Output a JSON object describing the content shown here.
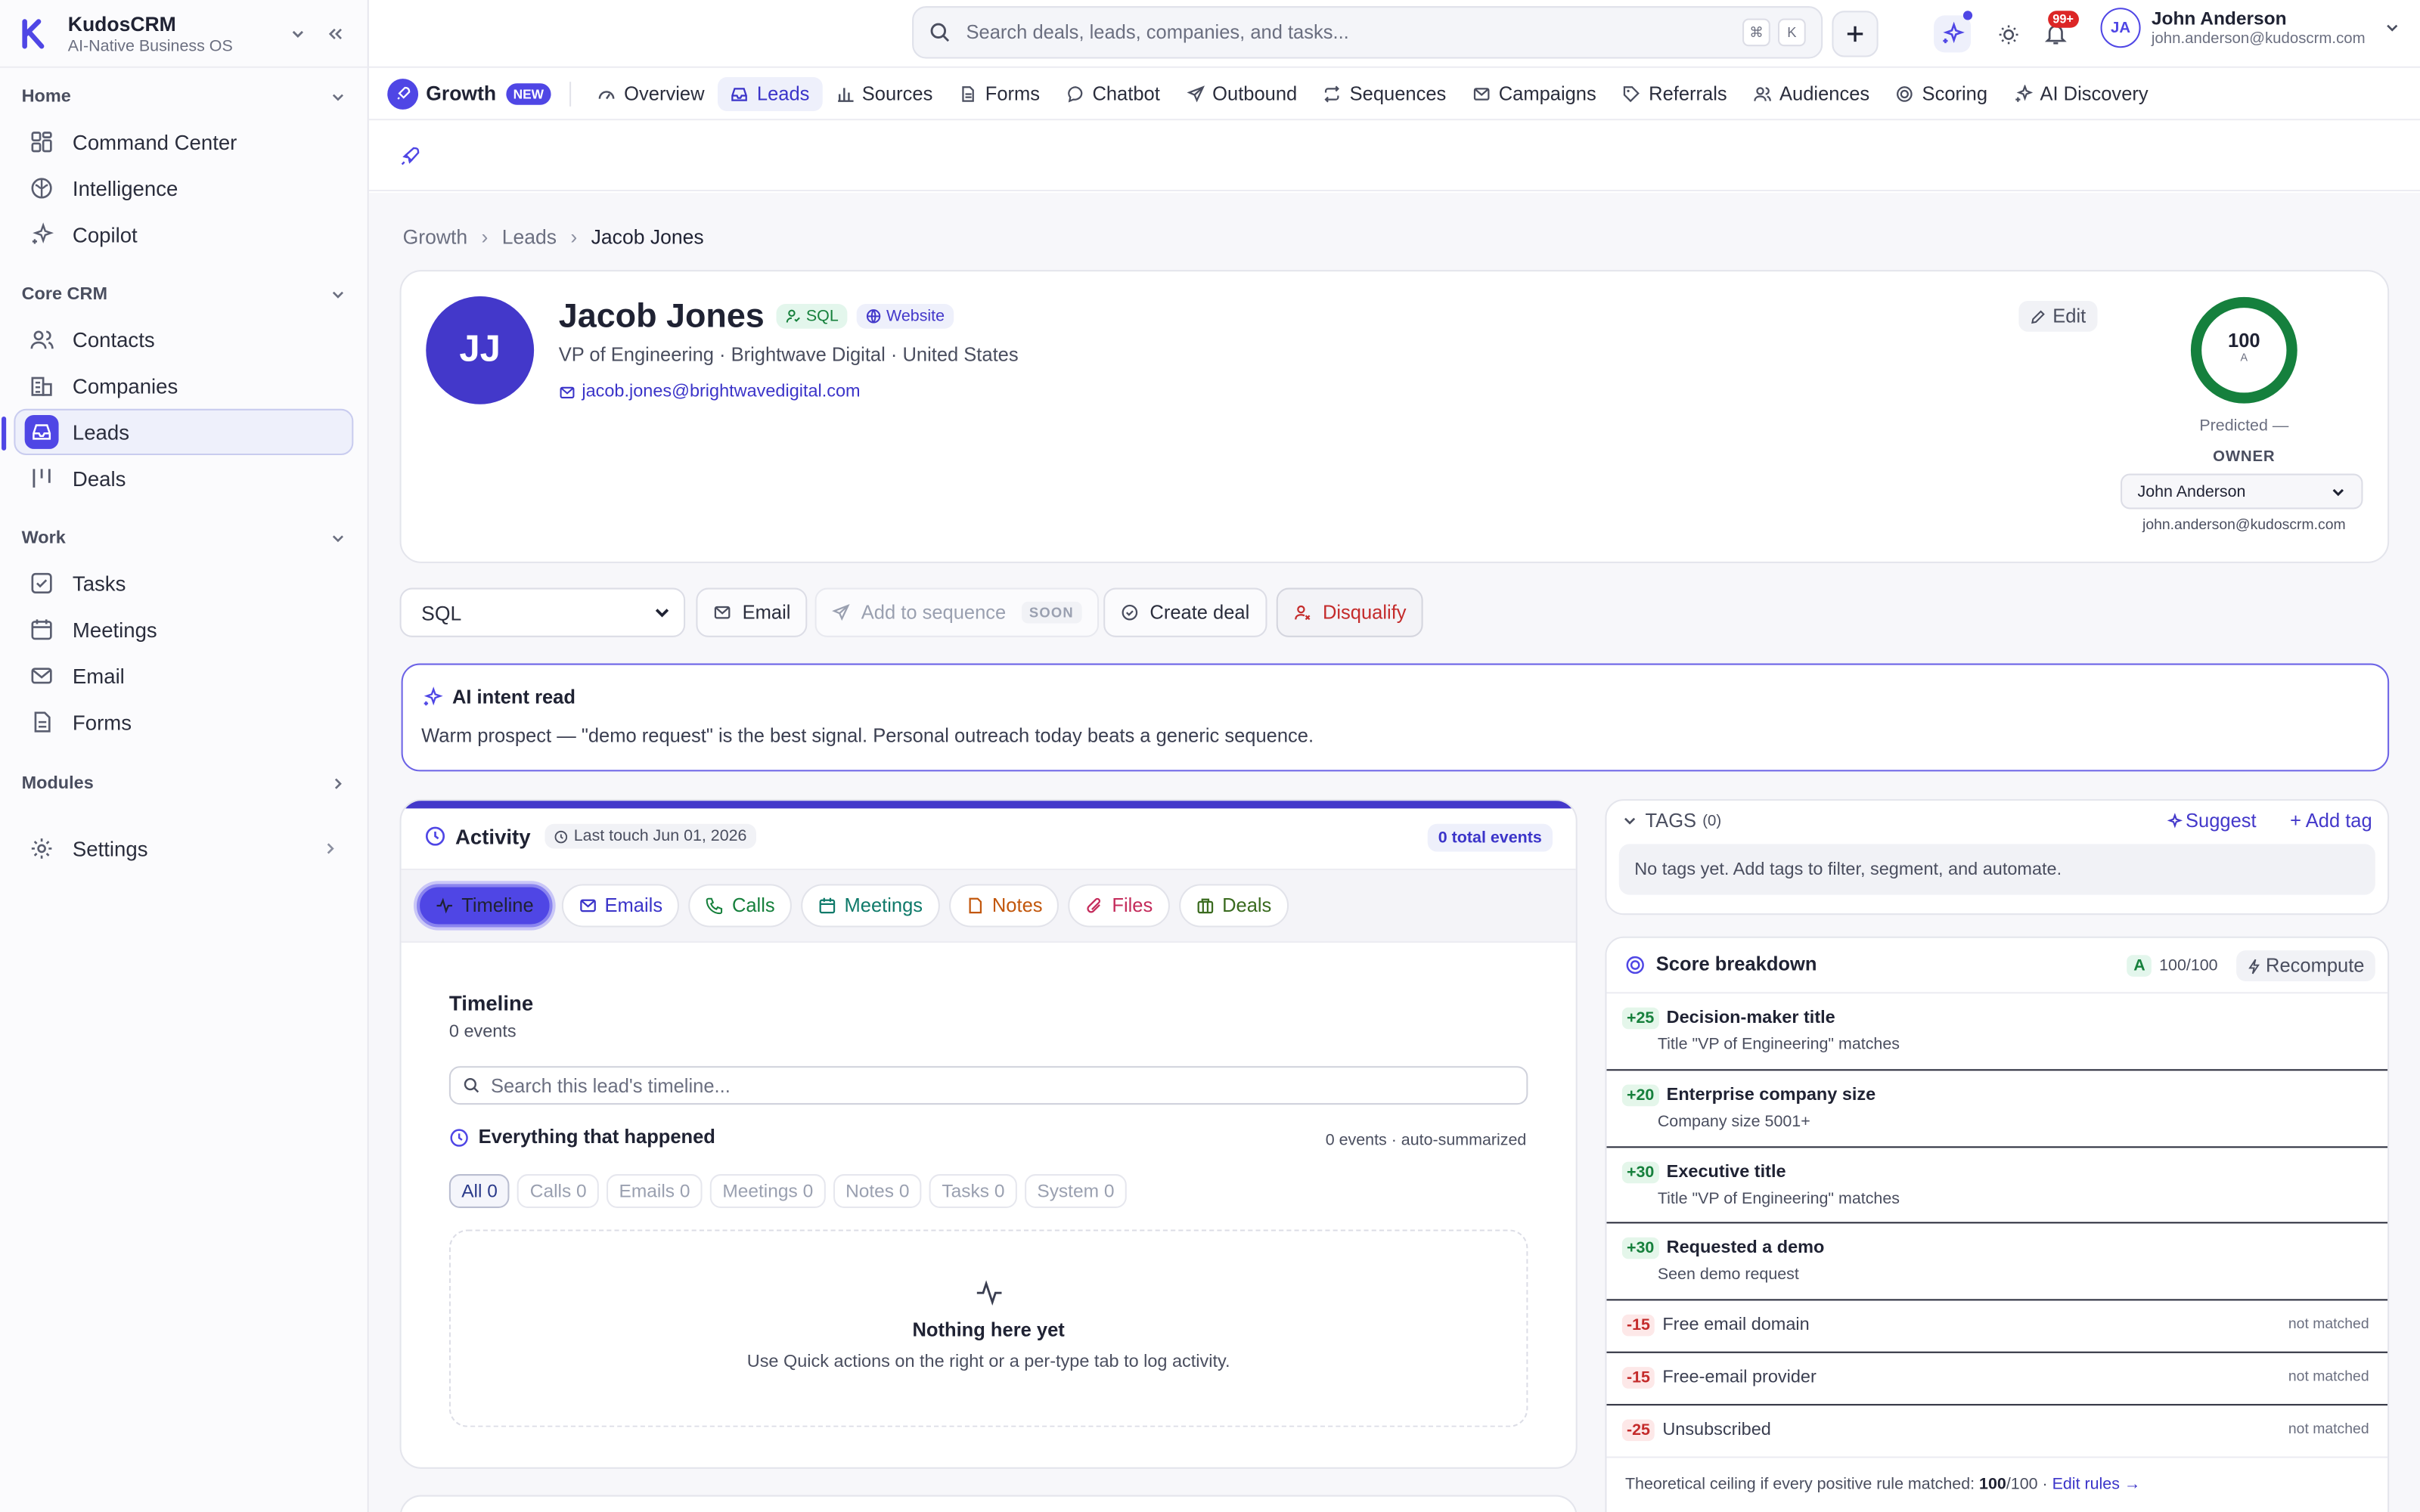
{
  "app": {
    "name": "KudosCRM",
    "tagline": "AI-Native Business OS"
  },
  "sidebar": {
    "sections": [
      {
        "label": "Home",
        "items": [
          {
            "label": "Command Center"
          },
          {
            "label": "Intelligence"
          },
          {
            "label": "Copilot"
          }
        ]
      },
      {
        "label": "Core CRM",
        "items": [
          {
            "label": "Contacts"
          },
          {
            "label": "Companies"
          },
          {
            "label": "Leads"
          },
          {
            "label": "Deals"
          }
        ]
      },
      {
        "label": "Work",
        "items": [
          {
            "label": "Tasks"
          },
          {
            "label": "Meetings"
          },
          {
            "label": "Email"
          },
          {
            "label": "Forms"
          }
        ]
      },
      {
        "label": "Modules"
      }
    ],
    "settings": "Settings"
  },
  "topbar": {
    "search_placeholder": "Search deals, leads, companies, and tasks...",
    "kbd1": "⌘",
    "kbd2": "K",
    "notif_badge": "99+",
    "user": {
      "initials": "JA",
      "name": "John Anderson",
      "email": "john.anderson@kudoscrm.com"
    }
  },
  "nav": {
    "section": "Growth",
    "new_badge": "NEW",
    "tabs": [
      "Overview",
      "Leads",
      "Sources",
      "Forms",
      "Chatbot",
      "Outbound",
      "Sequences",
      "Campaigns",
      "Referrals",
      "Audiences",
      "Scoring",
      "AI Discovery"
    ]
  },
  "breadcrumb": [
    "Growth",
    "Leads",
    "Jacob Jones"
  ],
  "lead": {
    "initials": "JJ",
    "name": "Jacob Jones",
    "stage_badge": "SQL",
    "source_badge": "Website",
    "subtitle": "VP of Engineering · Brightwave Digital · United States",
    "email": "jacob.jones@brightwavedigital.com",
    "edit": "Edit",
    "score": "100",
    "grade": "A",
    "predicted": "Predicted —",
    "owner_label": "OWNER",
    "owner": "John Anderson",
    "owner_email": "john.anderson@kudoscrm.com"
  },
  "actions": {
    "stage_value": "SQL",
    "email": "Email",
    "add_to_sequence": "Add to sequence",
    "soon": "SOON",
    "create_deal": "Create deal",
    "disqualify": "Disqualify"
  },
  "ai_intent": {
    "title": "AI intent read",
    "text": "Warm prospect — \"demo request\" is the best signal. Personal outreach today beats a generic sequence."
  },
  "activity": {
    "title": "Activity",
    "last_touch": "Last touch Jun 01, 2026",
    "total": "0 total events",
    "tabs": [
      "Timeline",
      "Emails",
      "Calls",
      "Meetings",
      "Notes",
      "Files",
      "Deals"
    ],
    "timeline_title": "Timeline",
    "timeline_count": "0 events",
    "search_placeholder": "Search this lead's timeline...",
    "happened": "Everything that happened",
    "summary": "0 events · auto-summarized",
    "filters": [
      {
        "label": "All",
        "count": "0"
      },
      {
        "label": "Calls",
        "count": "0"
      },
      {
        "label": "Emails",
        "count": "0"
      },
      {
        "label": "Meetings",
        "count": "0"
      },
      {
        "label": "Notes",
        "count": "0"
      },
      {
        "label": "Tasks",
        "count": "0"
      },
      {
        "label": "System",
        "count": "0"
      }
    ],
    "empty_title": "Nothing here yet",
    "empty_text": "Use Quick actions on the right or a per-type tab to log activity."
  },
  "tags": {
    "title": "TAGS",
    "count": "(0)",
    "suggest": "Suggest",
    "add": "+ Add tag",
    "empty": "No tags yet. Add tags to filter, segment, and automate."
  },
  "score": {
    "title": "Score breakdown",
    "grade": "A",
    "value": "100/100",
    "recompute": "Recompute",
    "rules": [
      {
        "delta": "+25",
        "title": "Decision-maker title",
        "detail": "Title \"VP of Engineering\" matches"
      },
      {
        "delta": "+20",
        "title": "Enterprise company size",
        "detail": "Company size 5001+"
      },
      {
        "delta": "+30",
        "title": "Executive title",
        "detail": "Title \"VP of Engineering\" matches"
      },
      {
        "delta": "+30",
        "title": "Requested a demo",
        "detail": "Seen demo request"
      },
      {
        "delta": "-15",
        "title": "Free email domain",
        "status": "not matched"
      },
      {
        "delta": "-15",
        "title": "Free-email provider",
        "status": "not matched"
      },
      {
        "delta": "-25",
        "title": "Unsubscribed",
        "status": "not matched"
      }
    ],
    "footer": "Theoretical ceiling if every positive rule matched:",
    "footer_value": "100",
    "footer_max": "/100",
    "edit_rules": "Edit rules →"
  },
  "colors": {
    "accent": "#4f46e5",
    "positive": "#16803c",
    "negative": "#c42b2b",
    "score_ring": "#15803d"
  }
}
